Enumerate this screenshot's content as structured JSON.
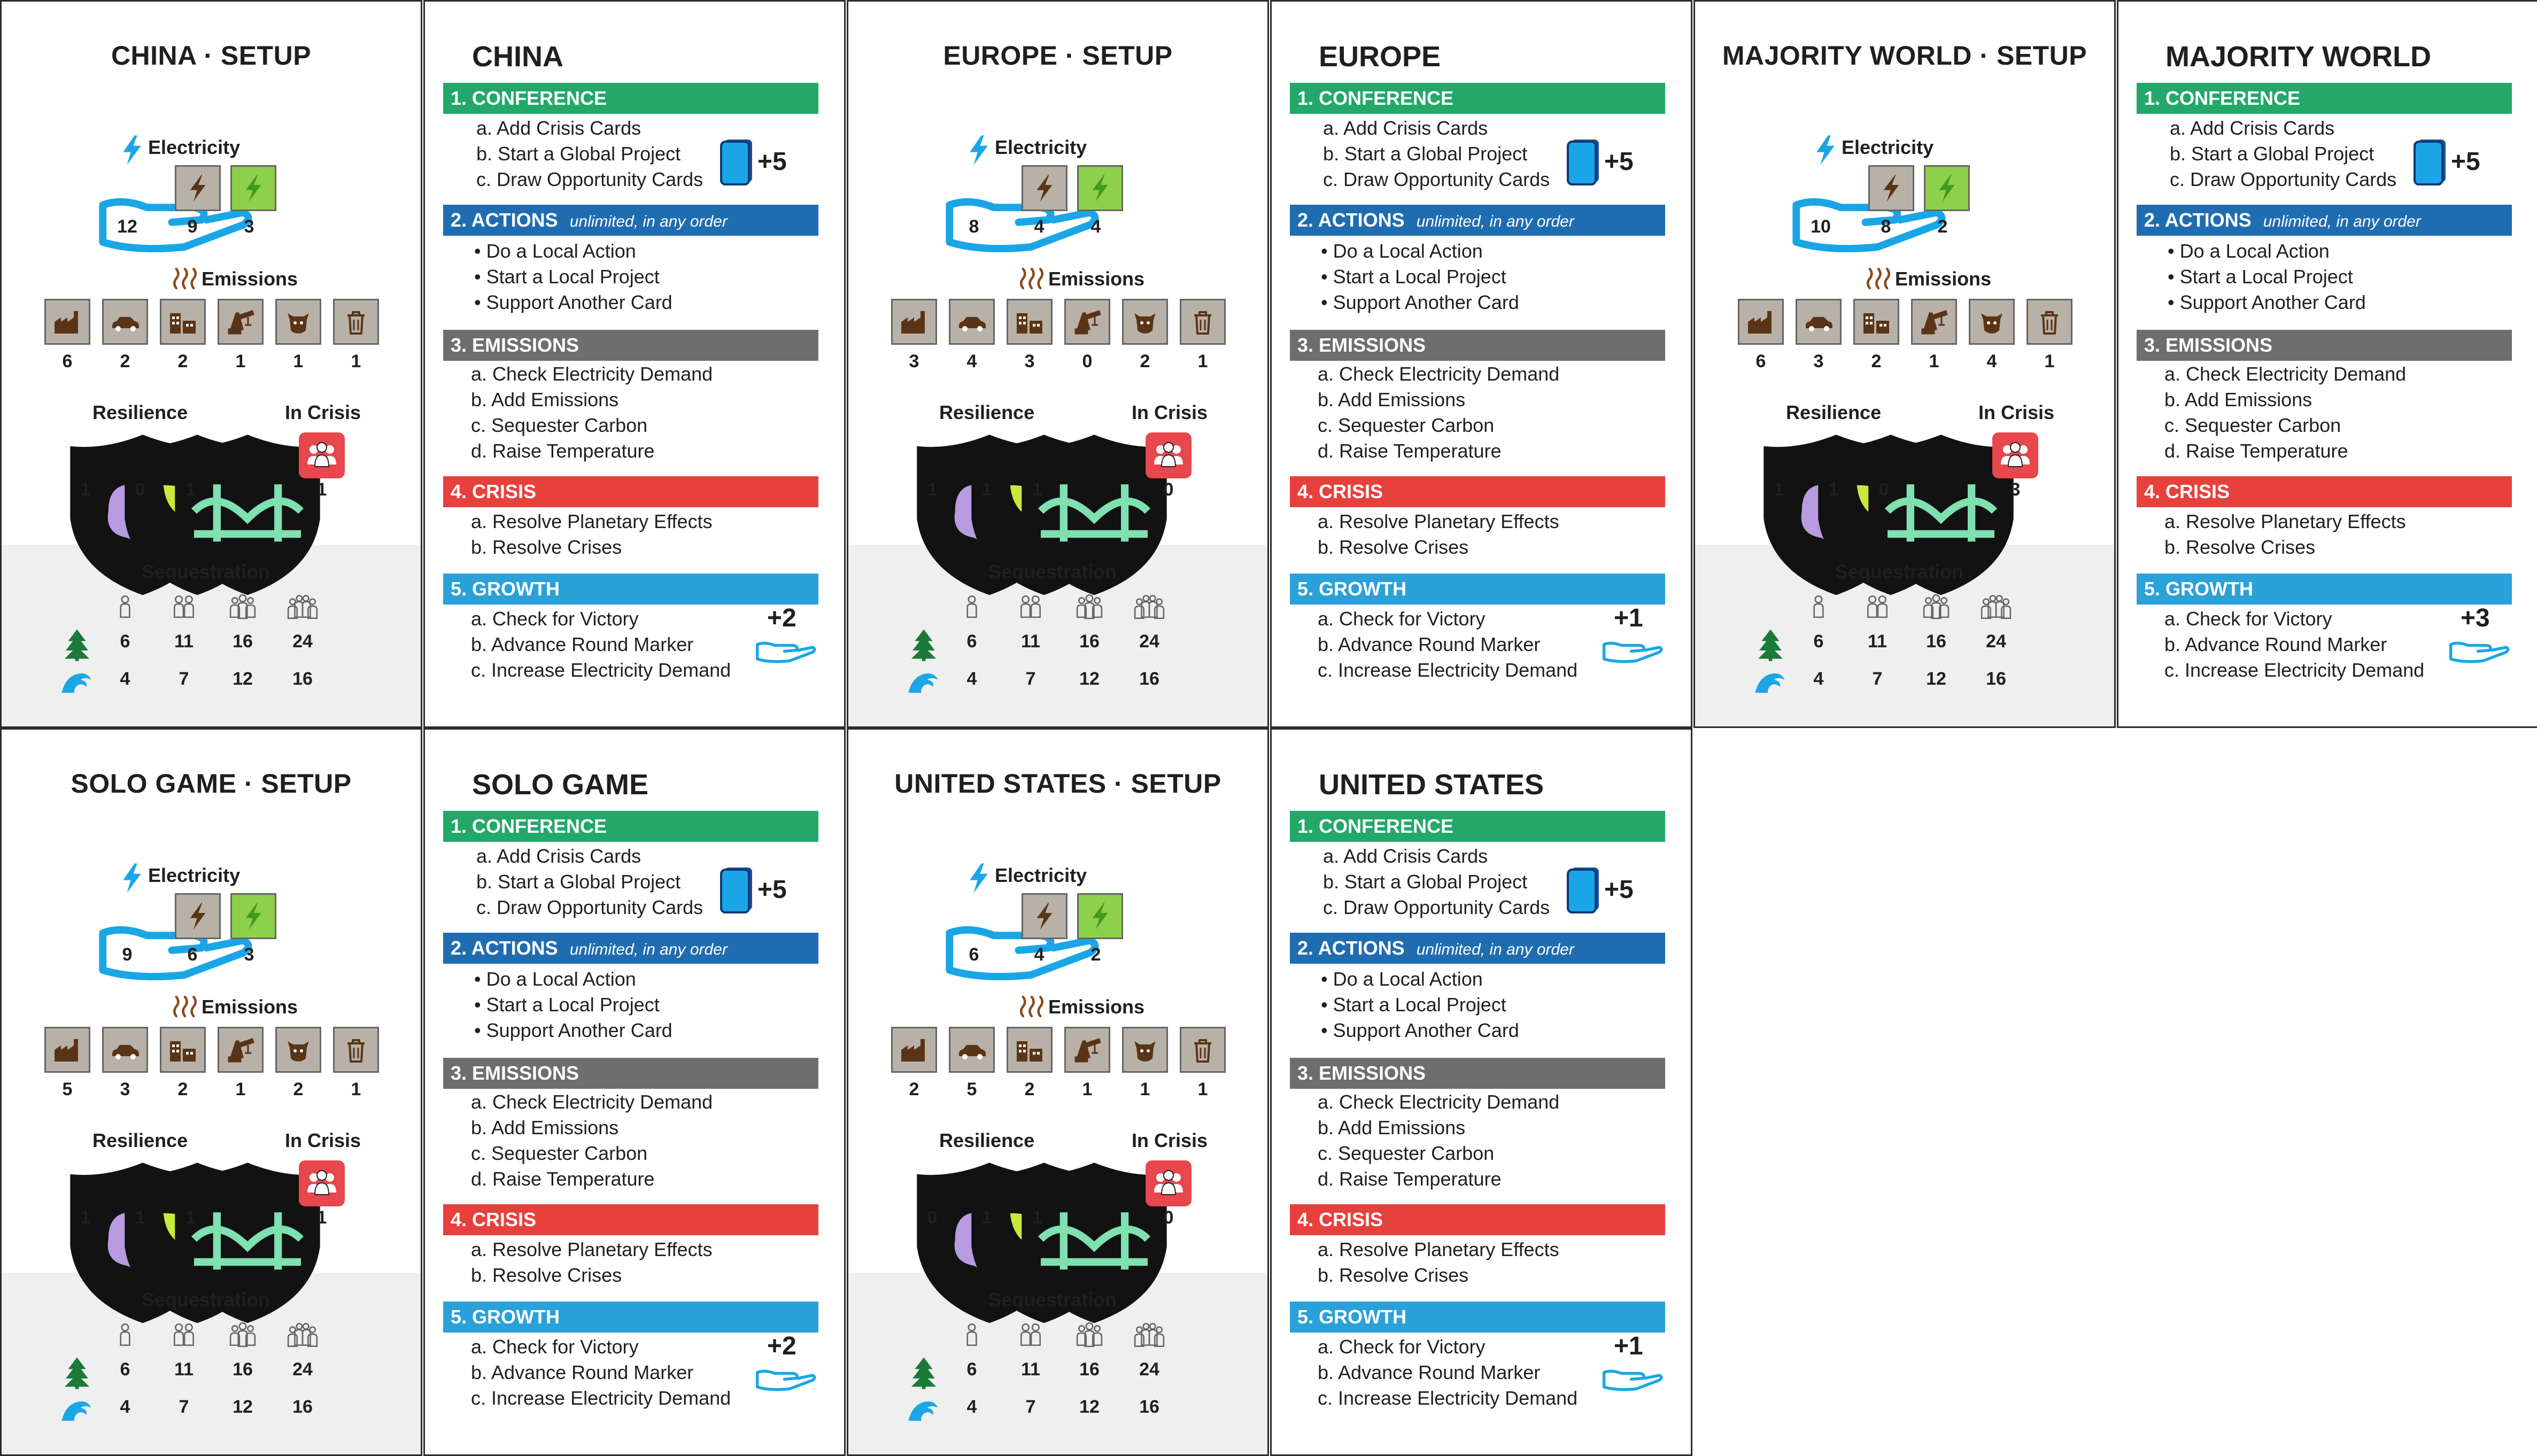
{
  "labels": {
    "electricity": "Electricity",
    "emissions": "Emissions",
    "resilience": "Resilience",
    "in_crisis": "In Crisis",
    "sequestration": "Sequestration",
    "unlimited": "unlimited, in any order"
  },
  "sequestration_rows": {
    "tree": [
      "6",
      "11",
      "16",
      "24"
    ],
    "wave": [
      "4",
      "7",
      "12",
      "16"
    ]
  },
  "phases": {
    "conference": {
      "header": "1. CONFERENCE",
      "items": [
        "a. Add Crisis Cards",
        "b. Start a Global Project",
        "c. Draw Opportunity Cards"
      ],
      "bonus": "+5"
    },
    "actions": {
      "header": "2. ACTIONS",
      "items": [
        "• Do a Local Action",
        "• Start a Local Project",
        "• Support Another Card"
      ]
    },
    "emissions": {
      "header": "3. EMISSIONS",
      "items": [
        "a.  Check Electricity Demand",
        "b.  Add Emissions",
        "c.  Sequester Carbon",
        "d.  Raise Temperature"
      ]
    },
    "crisis": {
      "header": "4. CRISIS",
      "items": [
        "a.  Resolve Planetary Effects",
        "b.  Resolve Crises"
      ]
    },
    "growth": {
      "header": "5. GROWTH",
      "items": [
        "a.  Check for Victory",
        "b.  Advance Round Marker",
        "c.  Increase Electricity Demand"
      ]
    }
  },
  "cards": [
    {
      "setup_title": "CHINA · SETUP",
      "turn_title": "CHINA",
      "electricity": [
        "12",
        "9",
        "3"
      ],
      "emissions": [
        "6",
        "2",
        "2",
        "1",
        "1",
        "1"
      ],
      "resilience": [
        "1",
        "0",
        "1"
      ],
      "in_crisis": "1",
      "growth_bonus": "+2"
    },
    {
      "setup_title": "EUROPE · SETUP",
      "turn_title": "EUROPE",
      "electricity": [
        "8",
        "4",
        "4"
      ],
      "emissions": [
        "3",
        "4",
        "3",
        "0",
        "2",
        "1"
      ],
      "resilience": [
        "1",
        "1",
        "1"
      ],
      "in_crisis": "0",
      "growth_bonus": "+1"
    },
    {
      "setup_title": "MAJORITY WORLD · SETUP",
      "turn_title": "MAJORITY WORLD",
      "electricity": [
        "10",
        "8",
        "2"
      ],
      "emissions": [
        "6",
        "3",
        "2",
        "1",
        "4",
        "1"
      ],
      "resilience": [
        "1",
        "1",
        "0"
      ],
      "in_crisis": "3",
      "growth_bonus": "+3"
    },
    {
      "setup_title": "SOLO GAME · SETUP",
      "turn_title": "SOLO GAME",
      "electricity": [
        "9",
        "6",
        "3"
      ],
      "emissions": [
        "5",
        "3",
        "2",
        "1",
        "2",
        "1"
      ],
      "resilience": [
        "1",
        "1",
        "1"
      ],
      "in_crisis": "1",
      "growth_bonus": "+2"
    },
    {
      "setup_title": "UNITED STATES · SETUP",
      "turn_title": "UNITED STATES",
      "electricity": [
        "6",
        "4",
        "2"
      ],
      "emissions": [
        "2",
        "5",
        "2",
        "1",
        "1",
        "1"
      ],
      "resilience": [
        "0",
        "1",
        "1"
      ],
      "in_crisis": "0",
      "growth_bonus": "+1"
    }
  ],
  "colors": {
    "conference": "#23a86a",
    "actions": "#1f6db0",
    "emissions": "#6e6e6e",
    "crisis": "#e8403c",
    "growth": "#2aa1d8",
    "crisis_token": "#e8474d",
    "renewable_tile": "#8fd04a",
    "fossil_tile": "#b8b1a8"
  }
}
